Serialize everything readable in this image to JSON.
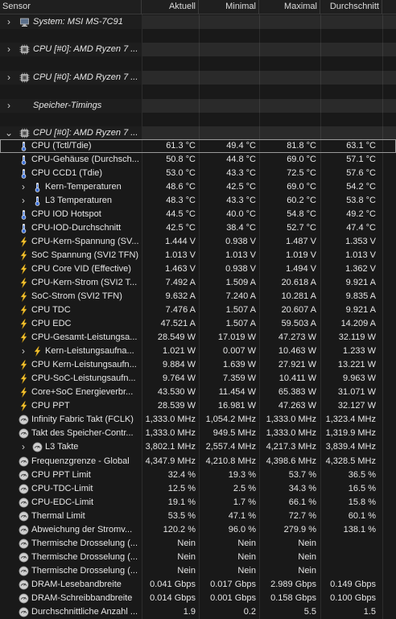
{
  "header": {
    "sensor": "Sensor",
    "current": "Aktuell",
    "min": "Minimal",
    "max": "Maximal",
    "avg": "Durchschnitt"
  },
  "groups": [
    {
      "label": "System: MSI MS-7C91",
      "icon": "computer-icon"
    },
    {
      "label": "CPU [#0]: AMD Ryzen 7 ...",
      "icon": "cpu-chip-icon"
    },
    {
      "label": "CPU [#0]: AMD Ryzen 7 ...",
      "icon": "cpu-chip-icon"
    },
    {
      "label": "Speicher-Timings",
      "icon": ""
    },
    {
      "label": "CPU [#0]: AMD Ryzen 7 ...",
      "icon": "cpu-chip-icon"
    }
  ],
  "sensors": [
    {
      "name": "CPU (Tctl/Tdie)",
      "icon": "thermometer-icon",
      "cur": "61.3 °C",
      "min": "49.4 °C",
      "max": "81.8 °C",
      "avg": "63.1 °C"
    },
    {
      "name": "CPU-Gehäuse (Durchsch...",
      "icon": "thermometer-icon",
      "cur": "50.8 °C",
      "min": "44.8 °C",
      "max": "69.0 °C",
      "avg": "57.1 °C"
    },
    {
      "name": "CPU CCD1 (Tdie)",
      "icon": "thermometer-icon",
      "cur": "53.0 °C",
      "min": "43.3 °C",
      "max": "72.5 °C",
      "avg": "57.6 °C"
    },
    {
      "name": "Kern-Temperaturen",
      "icon": "thermometer-icon",
      "sub": true,
      "cur": "48.6 °C",
      "min": "42.5 °C",
      "max": "69.0 °C",
      "avg": "54.2 °C"
    },
    {
      "name": "L3 Temperaturen",
      "icon": "thermometer-icon",
      "sub": true,
      "cur": "48.3 °C",
      "min": "43.3 °C",
      "max": "60.2 °C",
      "avg": "53.8 °C"
    },
    {
      "name": "CPU IOD Hotspot",
      "icon": "thermometer-icon",
      "cur": "44.5 °C",
      "min": "40.0 °C",
      "max": "54.8 °C",
      "avg": "49.2 °C"
    },
    {
      "name": "CPU-IOD-Durchschnitt",
      "icon": "thermometer-icon",
      "cur": "42.5 °C",
      "min": "38.4 °C",
      "max": "52.7 °C",
      "avg": "47.4 °C"
    },
    {
      "name": "CPU-Kern-Spannung (SV...",
      "icon": "lightning-icon",
      "cur": "1.444 V",
      "min": "0.938 V",
      "max": "1.487 V",
      "avg": "1.353 V"
    },
    {
      "name": "SoC Spannung (SVI2 TFN)",
      "icon": "lightning-icon",
      "cur": "1.013 V",
      "min": "1.013 V",
      "max": "1.019 V",
      "avg": "1.013 V"
    },
    {
      "name": "CPU Core VID (Effective)",
      "icon": "lightning-icon",
      "cur": "1.463 V",
      "min": "0.938 V",
      "max": "1.494 V",
      "avg": "1.362 V"
    },
    {
      "name": "CPU-Kern-Strom (SVI2 T...",
      "icon": "lightning-icon",
      "cur": "7.492 A",
      "min": "1.509 A",
      "max": "20.618 A",
      "avg": "9.921 A"
    },
    {
      "name": "SoC-Strom (SVI2 TFN)",
      "icon": "lightning-icon",
      "cur": "9.632 A",
      "min": "7.240 A",
      "max": "10.281 A",
      "avg": "9.835 A"
    },
    {
      "name": "CPU TDC",
      "icon": "lightning-icon",
      "cur": "7.476 A",
      "min": "1.507 A",
      "max": "20.607 A",
      "avg": "9.921 A"
    },
    {
      "name": "CPU EDC",
      "icon": "lightning-icon",
      "cur": "47.521 A",
      "min": "1.507 A",
      "max": "59.503 A",
      "avg": "14.209 A"
    },
    {
      "name": "CPU-Gesamt-Leistungsa...",
      "icon": "lightning-icon",
      "cur": "28.549 W",
      "min": "17.019 W",
      "max": "47.273 W",
      "avg": "32.119 W"
    },
    {
      "name": "Kern-Leistungsaufna...",
      "icon": "lightning-icon",
      "sub": true,
      "cur": "1.021 W",
      "min": "0.007 W",
      "max": "10.463 W",
      "avg": "1.233 W"
    },
    {
      "name": "CPU Kern-Leistungsaufn...",
      "icon": "lightning-icon",
      "cur": "9.884 W",
      "min": "1.639 W",
      "max": "27.921 W",
      "avg": "13.221 W"
    },
    {
      "name": "CPU-SoC-Leistungsaufn...",
      "icon": "lightning-icon",
      "cur": "9.764 W",
      "min": "7.359 W",
      "max": "10.411 W",
      "avg": "9.963 W"
    },
    {
      "name": "Core+SoC Energieverbr...",
      "icon": "lightning-icon",
      "cur": "43.530 W",
      "min": "11.454 W",
      "max": "65.383 W",
      "avg": "31.071 W"
    },
    {
      "name": "CPU PPT",
      "icon": "lightning-icon",
      "cur": "28.539 W",
      "min": "16.981 W",
      "max": "47.263 W",
      "avg": "32.127 W"
    },
    {
      "name": "Infinity Fabric Takt (FCLK)",
      "icon": "clock-icon",
      "cur": "1,333.0 MHz",
      "min": "1,054.2 MHz",
      "max": "1,333.0 MHz",
      "avg": "1,323.4 MHz"
    },
    {
      "name": "Takt des Speicher-Contr...",
      "icon": "clock-icon",
      "cur": "1,333.0 MHz",
      "min": "949.5 MHz",
      "max": "1,333.0 MHz",
      "avg": "1,319.9 MHz"
    },
    {
      "name": "L3 Takte",
      "icon": "clock-icon",
      "sub": true,
      "cur": "3,802.1 MHz",
      "min": "2,557.4 MHz",
      "max": "4,217.3 MHz",
      "avg": "3,839.4 MHz"
    },
    {
      "name": "Frequenzgrenze - Global",
      "icon": "clock-icon",
      "cur": "4,347.9 MHz",
      "min": "4,210.8 MHz",
      "max": "4,398.6 MHz",
      "avg": "4,328.5 MHz"
    },
    {
      "name": "CPU PPT Limit",
      "icon": "clock-icon",
      "cur": "32.4 %",
      "min": "19.3 %",
      "max": "53.7 %",
      "avg": "36.5 %"
    },
    {
      "name": "CPU-TDC-Limit",
      "icon": "clock-icon",
      "cur": "12.5 %",
      "min": "2.5 %",
      "max": "34.3 %",
      "avg": "16.5 %"
    },
    {
      "name": "CPU-EDC-Limit",
      "icon": "clock-icon",
      "cur": "19.1 %",
      "min": "1.7 %",
      "max": "66.1 %",
      "avg": "15.8 %"
    },
    {
      "name": "Thermal Limit",
      "icon": "clock-icon",
      "cur": "53.5 %",
      "min": "47.1 %",
      "max": "72.7 %",
      "avg": "60.1 %"
    },
    {
      "name": "Abweichung der Stromv...",
      "icon": "clock-icon",
      "cur": "120.2 %",
      "min": "96.0 %",
      "max": "279.9 %",
      "avg": "138.1 %"
    },
    {
      "name": "Thermische Drosselung (...",
      "icon": "clock-icon",
      "cur": "Nein",
      "min": "Nein",
      "max": "Nein",
      "avg": ""
    },
    {
      "name": "Thermische Drosselung (...",
      "icon": "clock-icon",
      "cur": "Nein",
      "min": "Nein",
      "max": "Nein",
      "avg": ""
    },
    {
      "name": "Thermische Drosselung (...",
      "icon": "clock-icon",
      "cur": "Nein",
      "min": "Nein",
      "max": "Nein",
      "avg": ""
    },
    {
      "name": "DRAM-Lesebandbreite",
      "icon": "clock-icon",
      "cur": "0.041 Gbps",
      "min": "0.017 Gbps",
      "max": "2.989 Gbps",
      "avg": "0.149 Gbps"
    },
    {
      "name": "DRAM-Schreibbandbreite",
      "icon": "clock-icon",
      "cur": "0.014 Gbps",
      "min": "0.001 Gbps",
      "max": "0.158 Gbps",
      "avg": "0.100 Gbps"
    },
    {
      "name": "Durchschnittliche Anzahl ...",
      "icon": "clock-icon",
      "cur": "1.9",
      "min": "0.2",
      "max": "5.5",
      "avg": "1.5"
    }
  ]
}
